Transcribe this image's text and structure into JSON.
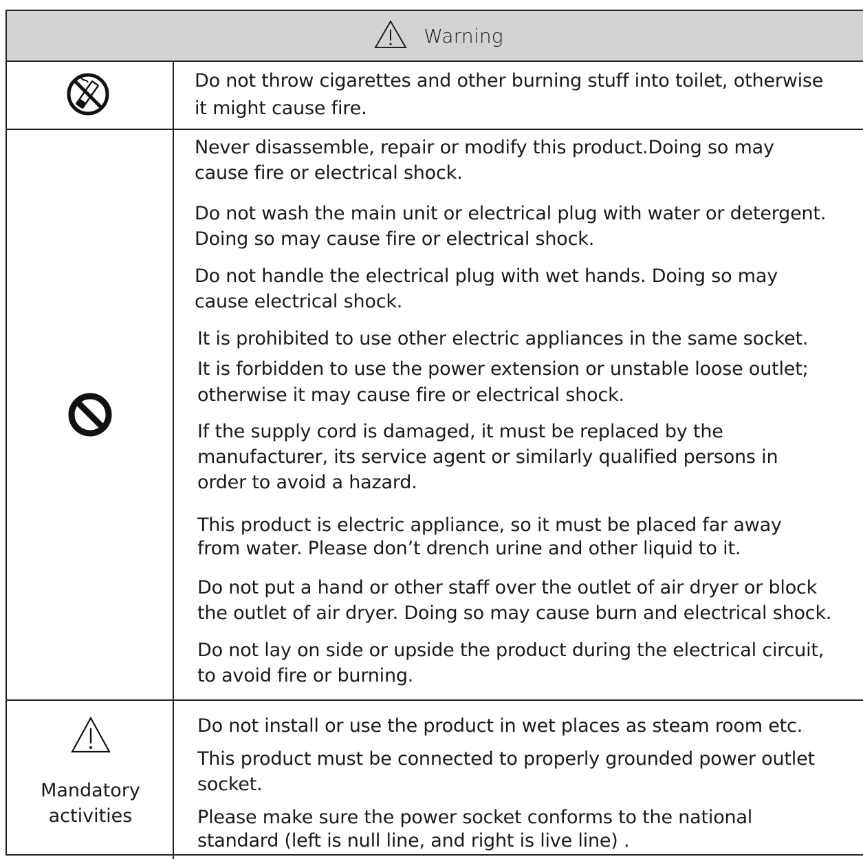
{
  "header": {
    "title": "Warning"
  },
  "rows": [
    {
      "icon": "no-smoking-icon",
      "lines": [
        "Do not throw cigarettes and other burning stuff into toilet, otherwise",
        "it might cause fire."
      ]
    },
    {
      "icon": "prohibition-icon",
      "lines": [
        "Never disassemble, repair or modify this product.Doing so may",
        "cause fire or electrical shock.",
        "Do not wash the main unit or electrical plug with water or detergent.",
        "Doing so may cause fire or electrical shock.",
        "Do not handle the electrical plug with wet hands. Doing so may",
        "cause electrical shock.",
        "It is prohibited to use other electric appliances in the same socket.",
        "It is forbidden to use the power extension or unstable loose outlet;",
        "otherwise it may cause fire or electrical shock.",
        "If the supply cord is damaged, it must be replaced by the",
        "manufacturer, its service agent or similarly qualified persons in",
        "order to avoid a hazard.",
        "This product is electric appliance, so it must be placed far away",
        "from water. Please don’t drench urine and other liquid to it.",
        "Do not put a hand or other staff over the outlet of air dryer or block",
        "the outlet of air dryer. Doing so may cause burn and electrical shock.",
        "Do not lay on side or upside the product during the electrical circuit,",
        "to avoid fire or burning."
      ]
    },
    {
      "icon": "warning-triangle-icon",
      "label": [
        "Mandatory",
        "activities"
      ],
      "lines": [
        "Do not install or use the product in wet places as steam room etc.",
        "This product must be connected to properly grounded power outlet",
        "socket.",
        "Please make sure the power socket conforms to the national",
        "standard (left is null line, and right is live line) ."
      ]
    }
  ]
}
